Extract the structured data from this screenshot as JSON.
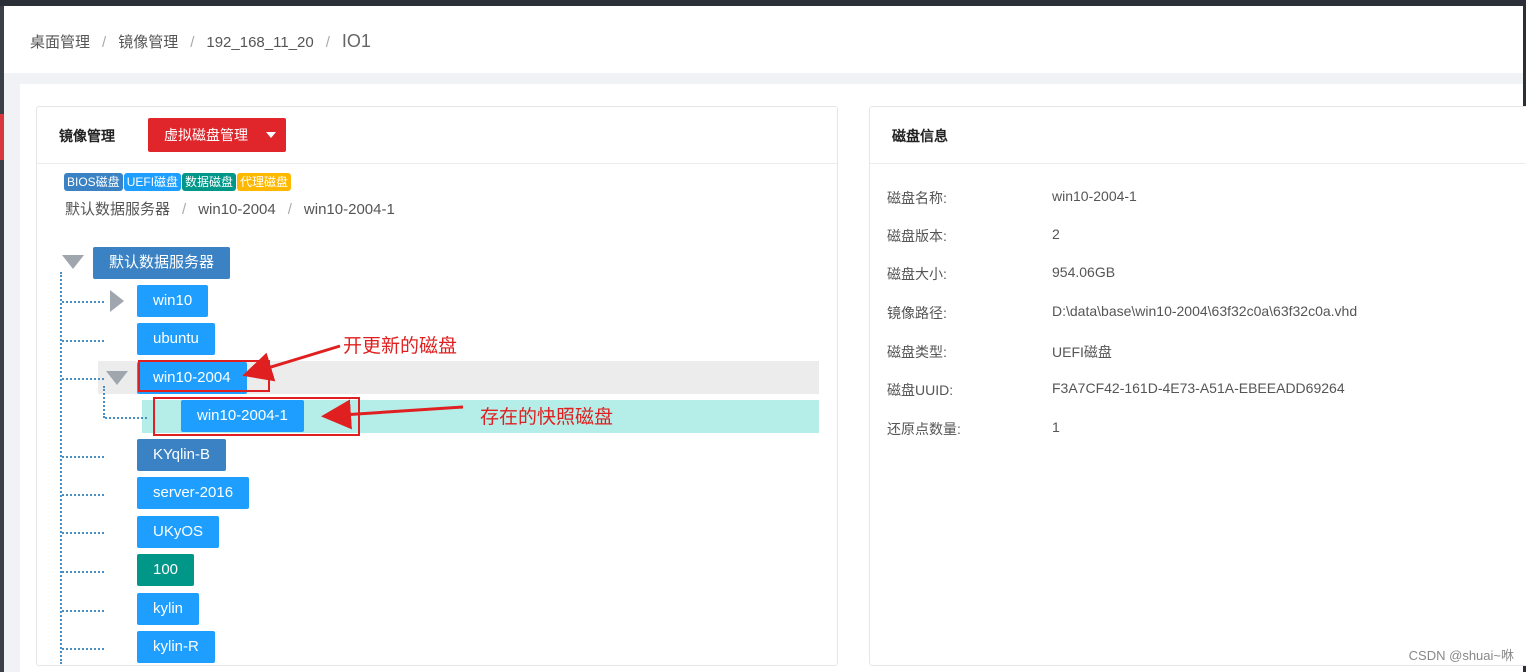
{
  "breadcrumb": {
    "items": [
      "桌面管理",
      "镜像管理",
      "192_168_11_20"
    ],
    "current": "IO1",
    "separator": "/"
  },
  "left_panel": {
    "title": "镜像管理",
    "vdisk_button": "虚拟磁盘管理",
    "legend": [
      {
        "label": "BIOS磁盘",
        "color": "#3a82c4"
      },
      {
        "label": "UEFI磁盘",
        "color": "#1e9fff"
      },
      {
        "label": "数据磁盘",
        "color": "#009688"
      },
      {
        "label": "代理磁盘",
        "color": "#ffb800"
      }
    ],
    "path": [
      "默认数据服务器",
      "win10-2004",
      "win10-2004-1"
    ],
    "tree": {
      "root": "默认数据服务器",
      "nodes": [
        "win10",
        "ubuntu",
        "win10-2004",
        "win10-2004-1",
        "KYqlin-B",
        "server-2016",
        "UKyOS",
        "100",
        "kylin",
        "kylin-R"
      ]
    }
  },
  "annotations": {
    "updated_disk": "开更新的磁盘",
    "snapshot_disk": "存在的快照磁盘"
  },
  "right_panel": {
    "title": "磁盘信息",
    "rows": [
      {
        "key": "磁盘名称:",
        "value": "win10-2004-1"
      },
      {
        "key": "磁盘版本:",
        "value": "2"
      },
      {
        "key": "磁盘大小:",
        "value": "954.06GB"
      },
      {
        "key": "镜像路径:",
        "value": "D:\\data\\base\\win10-2004\\63f32c0a\\63f32c0a.vhd"
      },
      {
        "key": "磁盘类型:",
        "value": "UEFI磁盘"
      },
      {
        "key": "磁盘UUID:",
        "value": "F3A7CF42-161D-4E73-A51A-EBEEADD69264"
      },
      {
        "key": "还原点数量:",
        "value": "1"
      }
    ]
  },
  "watermark": "CSDN @shuai~咻",
  "colors": {
    "bios": "#3a82c4",
    "uefi": "#1e9fff",
    "data": "#009688",
    "agent": "#ffb800",
    "danger": "#e0262b",
    "selected_row": "#b5ede8",
    "hover_row": "#ececec"
  }
}
